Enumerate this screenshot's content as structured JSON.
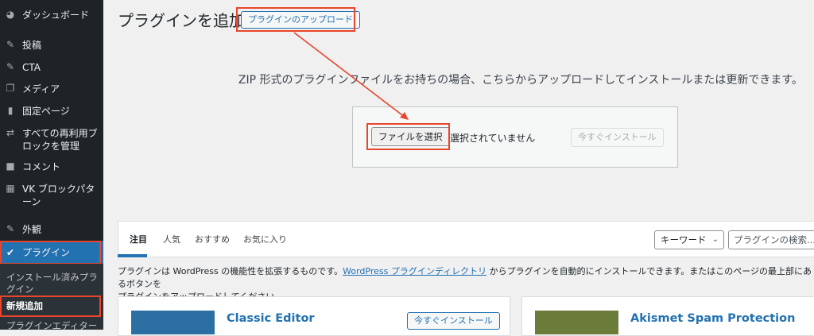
{
  "sidebar": {
    "items": [
      {
        "icon": "dashboard-icon",
        "glyph": "◕",
        "label": "ダッシュボード"
      },
      {
        "icon": "pushpin-icon",
        "glyph": "✎",
        "label": "投稿"
      },
      {
        "icon": "pushpin-icon",
        "glyph": "✎",
        "label": "CTA"
      },
      {
        "icon": "media-icon",
        "glyph": "❐",
        "label": "メディア"
      },
      {
        "icon": "page-icon",
        "glyph": "▮",
        "label": "固定ページ"
      },
      {
        "icon": "reusable-block-icon",
        "glyph": "⇄",
        "label": "すべての再利用ブロックを管理"
      },
      {
        "icon": "comment-icon",
        "glyph": "■",
        "label": "コメント"
      },
      {
        "icon": "grid-icon",
        "glyph": "▦",
        "label": "VK ブロックパターン"
      },
      {
        "icon": "appearance-icon",
        "glyph": "✎",
        "label": "外観"
      },
      {
        "icon": "plugin-icon",
        "glyph": "✔",
        "label": "プラグイン"
      }
    ],
    "submenu": [
      {
        "label": "インストール済みプラグイン"
      },
      {
        "label": "新規追加"
      },
      {
        "label": "プラグインエディター"
      }
    ]
  },
  "page": {
    "title": "プラグインを追加",
    "upload_button": "プラグインのアップロード",
    "description": "ZIP 形式のプラグインファイルをお持ちの場合、こちらからアップロードしてインストールまたは更新できます。",
    "choose_file": "ファイルを選択",
    "no_file": "選択されていません",
    "install_now": "今すぐインストール"
  },
  "filter": {
    "tabs": [
      "注目",
      "人気",
      "おすすめ",
      "お気に入り"
    ],
    "type_select": "キーワード",
    "search_placeholder": "プラグインの検索..."
  },
  "help": {
    "pre": "プラグインは WordPress の機能性を拡張するものです。",
    "link": "WordPress プラグインディレクトリ",
    "post": " からプラグインを自動的にインストールできます。またはこのページの最上部にあるボタンを",
    "line2": "プラグインをアップロードしてください。"
  },
  "cards": [
    {
      "name": "Classic Editor",
      "install": "今すぐインストール",
      "thumb_color": "#2c6fa3"
    },
    {
      "name": "Akismet Spam Protection",
      "thumb_color": "#6b7b3a"
    }
  ],
  "colors": {
    "accent": "#2271b1",
    "annotation": "#e8452c",
    "sidebar": "#1d2327"
  }
}
